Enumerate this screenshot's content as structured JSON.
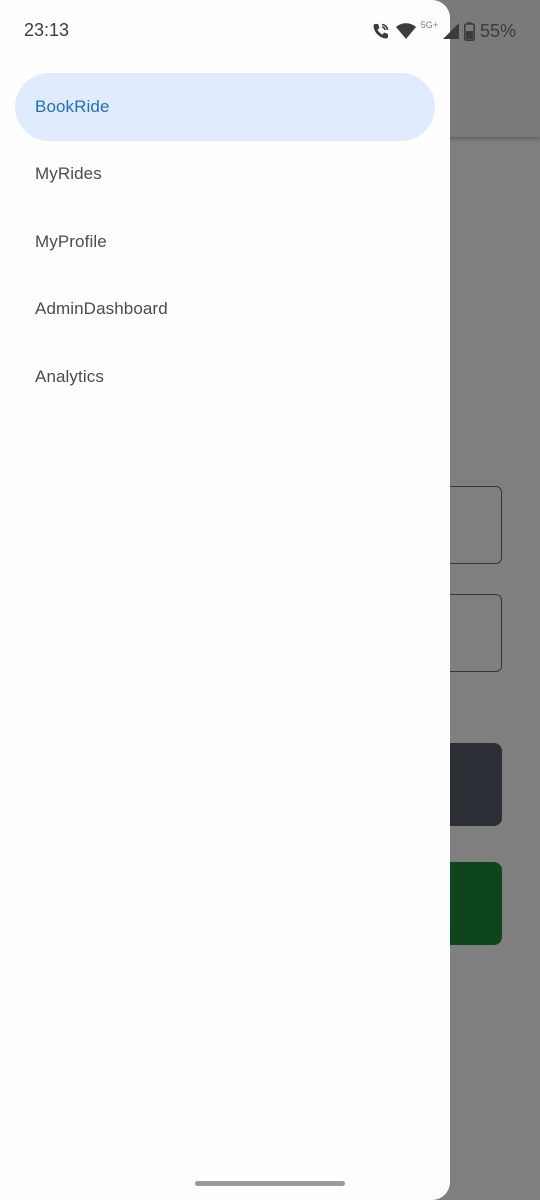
{
  "status_bar": {
    "time": "23:13",
    "network": "5G+",
    "battery": "55%",
    "icons": [
      "wifi-calling-icon",
      "wifi-icon",
      "signal-icon",
      "battery-icon"
    ]
  },
  "drawer": {
    "items": [
      {
        "label": "BookRide",
        "active": true
      },
      {
        "label": "MyRides",
        "active": false
      },
      {
        "label": "MyProfile",
        "active": false
      },
      {
        "label": "AdminDashboard",
        "active": false
      },
      {
        "label": "Analytics",
        "active": false
      }
    ]
  },
  "colors": {
    "active_item_bg": "#e0ecfd",
    "active_item_text": "#1a6fcb",
    "item_text": "#4b4b4b",
    "drawer_bg": "#fefefe",
    "background_button_dark": "#5a5f6e",
    "background_button_green": "#1f8b3a"
  }
}
